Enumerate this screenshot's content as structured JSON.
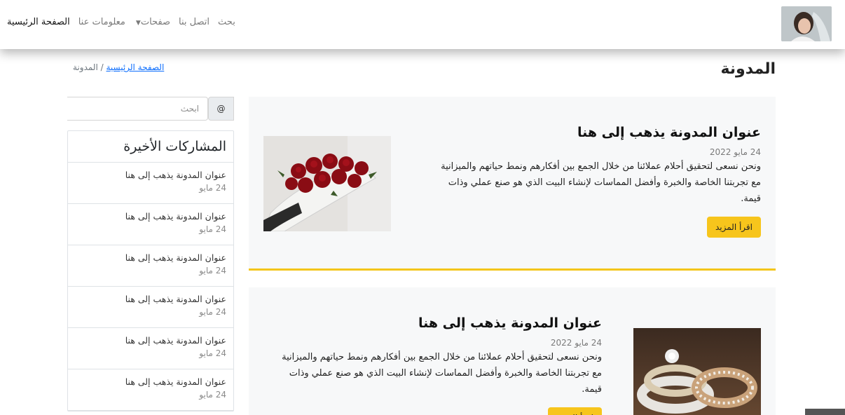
{
  "nav": {
    "links": [
      {
        "label": "الصفحة الرئيسية",
        "active": true
      },
      {
        "label": "معلومات عنا",
        "active": false
      },
      {
        "label": "صفحات",
        "active": false,
        "dropdown": true
      },
      {
        "label": "اتصل بنا",
        "active": false
      },
      {
        "label": "بحث",
        "active": false
      }
    ],
    "caret_icon": "caret-down-icon"
  },
  "page": {
    "title": "المدونة",
    "breadcrumb": {
      "home": "الصفحة الرئيسية",
      "separator": "/",
      "current": "المدونة"
    }
  },
  "search": {
    "placeholder": "ابحث",
    "button_label": "@"
  },
  "recent": {
    "title": "المشاركات الأخيرة",
    "items": [
      {
        "title": "عنوان المدونة يذهب إلى هنا",
        "date": "24 مايو"
      },
      {
        "title": "عنوان المدونة يذهب إلى هنا",
        "date": "24 مايو"
      },
      {
        "title": "عنوان المدونة يذهب إلى هنا",
        "date": "24 مايو"
      },
      {
        "title": "عنوان المدونة يذهب إلى هنا",
        "date": "24 مايو"
      },
      {
        "title": "عنوان المدونة يذهب إلى هنا",
        "date": "24 مايو"
      },
      {
        "title": "عنوان المدونة يذهب إلى هنا",
        "date": "24 مايو"
      }
    ]
  },
  "posts": [
    {
      "title": "عنوان المدونة يذهب إلى هنا",
      "date": "24 مايو 2022",
      "text": "ونحن نسعى لتحقيق أحلام عملائنا من خلال الجمع بين أفكارهم ونمط حياتهم والميزانية مع تجربتنا الخاصة والخبرة وأفضل المماسات لإنشاء البيت الذي هو صنع عملي وذات قيمة.",
      "button": "اقرأ المزيد"
    },
    {
      "title": "عنوان المدونة يذهب إلى هنا",
      "date": "24 مايو 2022",
      "text": "ونحن نسعى لتحقيق أحلام عملائنا من خلال الجمع بين أفكارهم ونمط حياتهم والميزانية مع تجربتنا الخاصة والخبرة وأفضل المماسات لإنشاء البيت الذي هو صنع عملي وذات قيمة.",
      "button": "اقرأ المزيد"
    }
  ],
  "colors": {
    "accent": "#f7c51c",
    "link": "#0d6efd",
    "post_bg": "#f7f8f9"
  }
}
